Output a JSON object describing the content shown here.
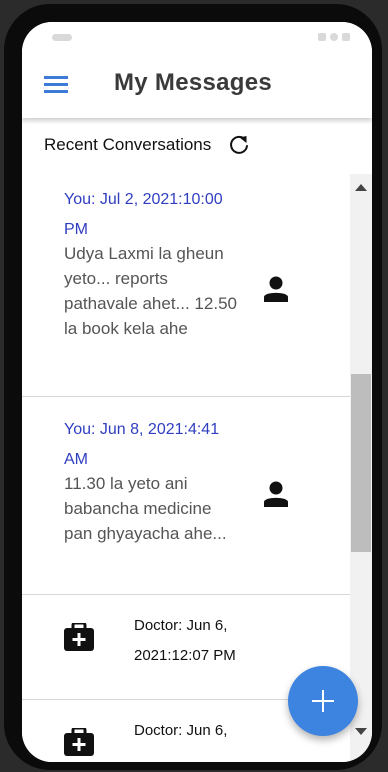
{
  "header": {
    "title": "My Messages"
  },
  "section": {
    "title": "Recent Conversations"
  },
  "conversations": [
    {
      "time": "You: Jul 2, 2021:10:00 PM",
      "message": "Udya Laxmi la gheun yeto... reports pathavale ahet... 12.50 la book kela ahe",
      "icon": "person-icon"
    },
    {
      "time": "You: Jun 8, 2021:4:41 AM",
      "message": "11.30 la yeto ani babancha medicine pan ghyayacha ahe...",
      "icon": "person-icon"
    },
    {
      "text": "Doctor: Jun 6, 2021:12:07 PM",
      "icon": "medical-bag-icon"
    },
    {
      "text": "Doctor: Jun 6,",
      "icon": "medical-bag-icon"
    }
  ],
  "fab": {
    "icon": "plus-icon"
  },
  "colors": {
    "accent": "#3d7bd8",
    "you_time": "#2f3ec0",
    "fab": "#3d84e0"
  }
}
